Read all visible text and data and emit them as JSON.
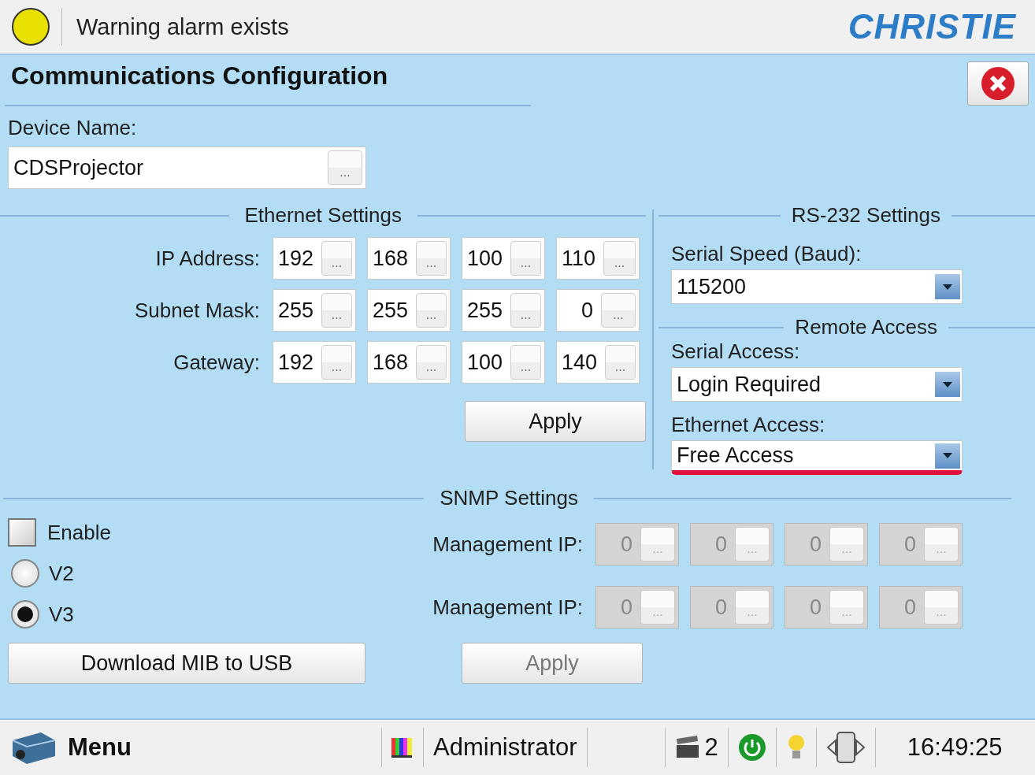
{
  "status": {
    "message": "Warning alarm exists",
    "warning_active": true
  },
  "logo": "CHRISTIE",
  "dialog": {
    "title": "Communications Configuration"
  },
  "device_name": {
    "label": "Device Name:",
    "value": "CDSProjector",
    "button": "..."
  },
  "ethernet": {
    "title": "Ethernet Settings",
    "rows": [
      {
        "label": "IP Address:",
        "disabled": false,
        "octets": [
          {
            "value": "192",
            "button": "..."
          },
          {
            "value": "168",
            "button": "..."
          },
          {
            "value": "100",
            "button": "..."
          },
          {
            "value": "110",
            "button": "..."
          }
        ]
      },
      {
        "label": "Subnet Mask:",
        "disabled": false,
        "octets": [
          {
            "value": "255",
            "button": "..."
          },
          {
            "value": "255",
            "button": "..."
          },
          {
            "value": "255",
            "button": "..."
          },
          {
            "value": "0",
            "button": "..."
          }
        ]
      },
      {
        "label": "Gateway:",
        "disabled": false,
        "octets": [
          {
            "value": "192",
            "button": "..."
          },
          {
            "value": "168",
            "button": "..."
          },
          {
            "value": "100",
            "button": "..."
          },
          {
            "value": "140",
            "button": "..."
          }
        ]
      }
    ],
    "apply": {
      "label": "Apply",
      "disabled": false
    }
  },
  "rs232": {
    "title": "RS-232 Settings",
    "serial_speed": {
      "label": "Serial Speed (Baud):",
      "value": "115200",
      "highlighted": false
    }
  },
  "remote_access": {
    "title": "Remote Access",
    "fields": [
      {
        "label": "Serial Access:",
        "value": "Login Required",
        "highlighted": false
      },
      {
        "label": "Ethernet Access:",
        "value": "Free Access",
        "highlighted": true
      }
    ]
  },
  "snmp": {
    "title": "SNMP Settings",
    "enable": {
      "label": "Enable",
      "checked": false
    },
    "versions": [
      {
        "label": "V2",
        "selected": false
      },
      {
        "label": "V3",
        "selected": true
      }
    ],
    "rows": [
      {
        "label": "Management IP:",
        "disabled": true,
        "octets": [
          {
            "value": "0",
            "button": "..."
          },
          {
            "value": "0",
            "button": "..."
          },
          {
            "value": "0",
            "button": "..."
          },
          {
            "value": "0",
            "button": "..."
          }
        ]
      },
      {
        "label": "Management IP:",
        "disabled": true,
        "octets": [
          {
            "value": "0",
            "button": "..."
          },
          {
            "value": "0",
            "button": "..."
          },
          {
            "value": "0",
            "button": "..."
          },
          {
            "value": "0",
            "button": "..."
          }
        ]
      }
    ],
    "download": {
      "label": "Download MIB to USB",
      "disabled": false
    },
    "apply": {
      "label": "Apply",
      "disabled": true
    }
  },
  "taskbar": {
    "menu": "Menu",
    "user": "Administrator",
    "count": "2",
    "time": "16:49:25"
  }
}
